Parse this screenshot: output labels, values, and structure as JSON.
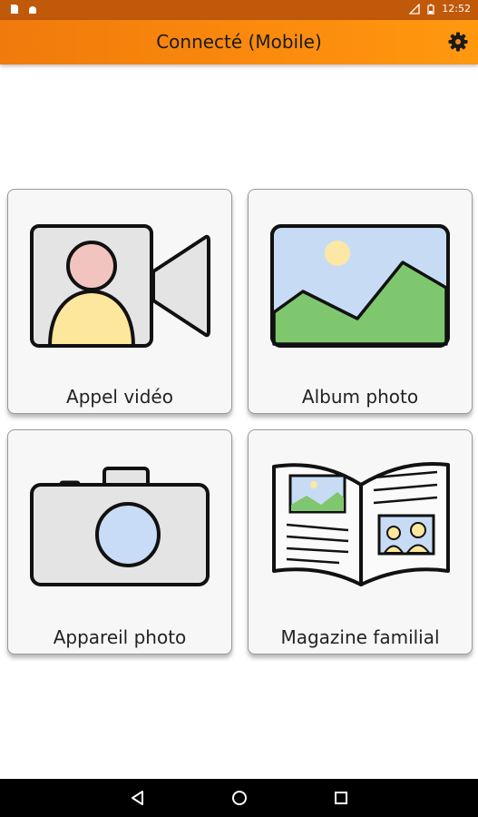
{
  "status_bar": {
    "time": "12:52",
    "icons": [
      "sim-card-icon",
      "android-icon",
      "no-signal-icon",
      "battery-icon"
    ]
  },
  "app_bar": {
    "title": "Connecté (Mobile)",
    "settings_icon": "gear-icon"
  },
  "tiles": [
    {
      "label": "Appel vidéo",
      "icon": "video-call-icon"
    },
    {
      "label": "Album photo",
      "icon": "photo-album-icon"
    },
    {
      "label": "Appareil photo",
      "icon": "camera-icon"
    },
    {
      "label": "Magazine familial",
      "icon": "magazine-icon"
    }
  ],
  "nav_bar": {
    "buttons": [
      "back-icon",
      "home-icon",
      "recents-icon"
    ]
  },
  "colors": {
    "app_bar": "#fb8a0d",
    "status_bar": "#c0590a",
    "tile_bg": "#f7f7f7"
  }
}
